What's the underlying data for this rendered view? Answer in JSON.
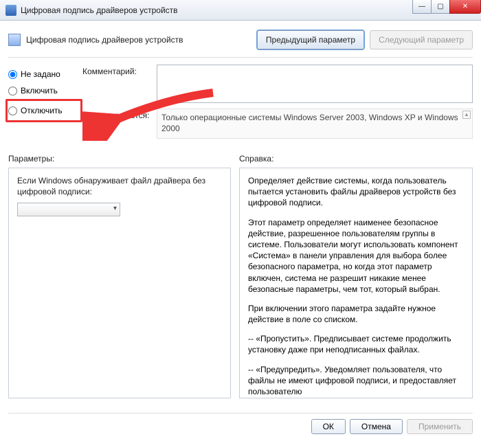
{
  "window": {
    "title": "Цифровая подпись драйверов устройств"
  },
  "header": {
    "title": "Цифровая подпись драйверов устройств",
    "prev": "Предыдущий параметр",
    "next": "Следующий параметр"
  },
  "state": {
    "not_configured": "Не задано",
    "enabled": "Включить",
    "disabled": "Отключить"
  },
  "labels": {
    "comment": "Комментарий:",
    "supported": "Поддерживается:",
    "parameters": "Параметры:",
    "help": "Справка:"
  },
  "supported_text": "Только операционные системы Windows Server 2003, Windows XP и Windows 2000",
  "parameters": {
    "driver_prompt": "Если Windows обнаруживает файл драйвера без цифровой подписи:"
  },
  "help": {
    "p1": "Определяет действие системы, когда пользователь пытается установить файлы драйверов устройств без цифровой подписи.",
    "p2": "Этот параметр определяет наименее безопасное действие, разрешенное пользователям группы в системе. Пользователи могут использовать компонент «Система» в панели управления для выбора более безопасного параметра, но когда этот параметр включен, система не разрешит никакие менее безопасные параметры, чем тот, который выбран.",
    "p3": "При включении этого параметра задайте нужное действие в поле со списком.",
    "p4": "-- «Пропустить». Предписывает системе продолжить установку даже при неподписанных файлах.",
    "p5": "-- «Предупредить». Уведомляет пользователя, что файлы не имеют цифровой подписи, и предоставляет пользователю"
  },
  "buttons": {
    "ok": "ОК",
    "cancel": "Отмена",
    "apply": "Применить"
  }
}
